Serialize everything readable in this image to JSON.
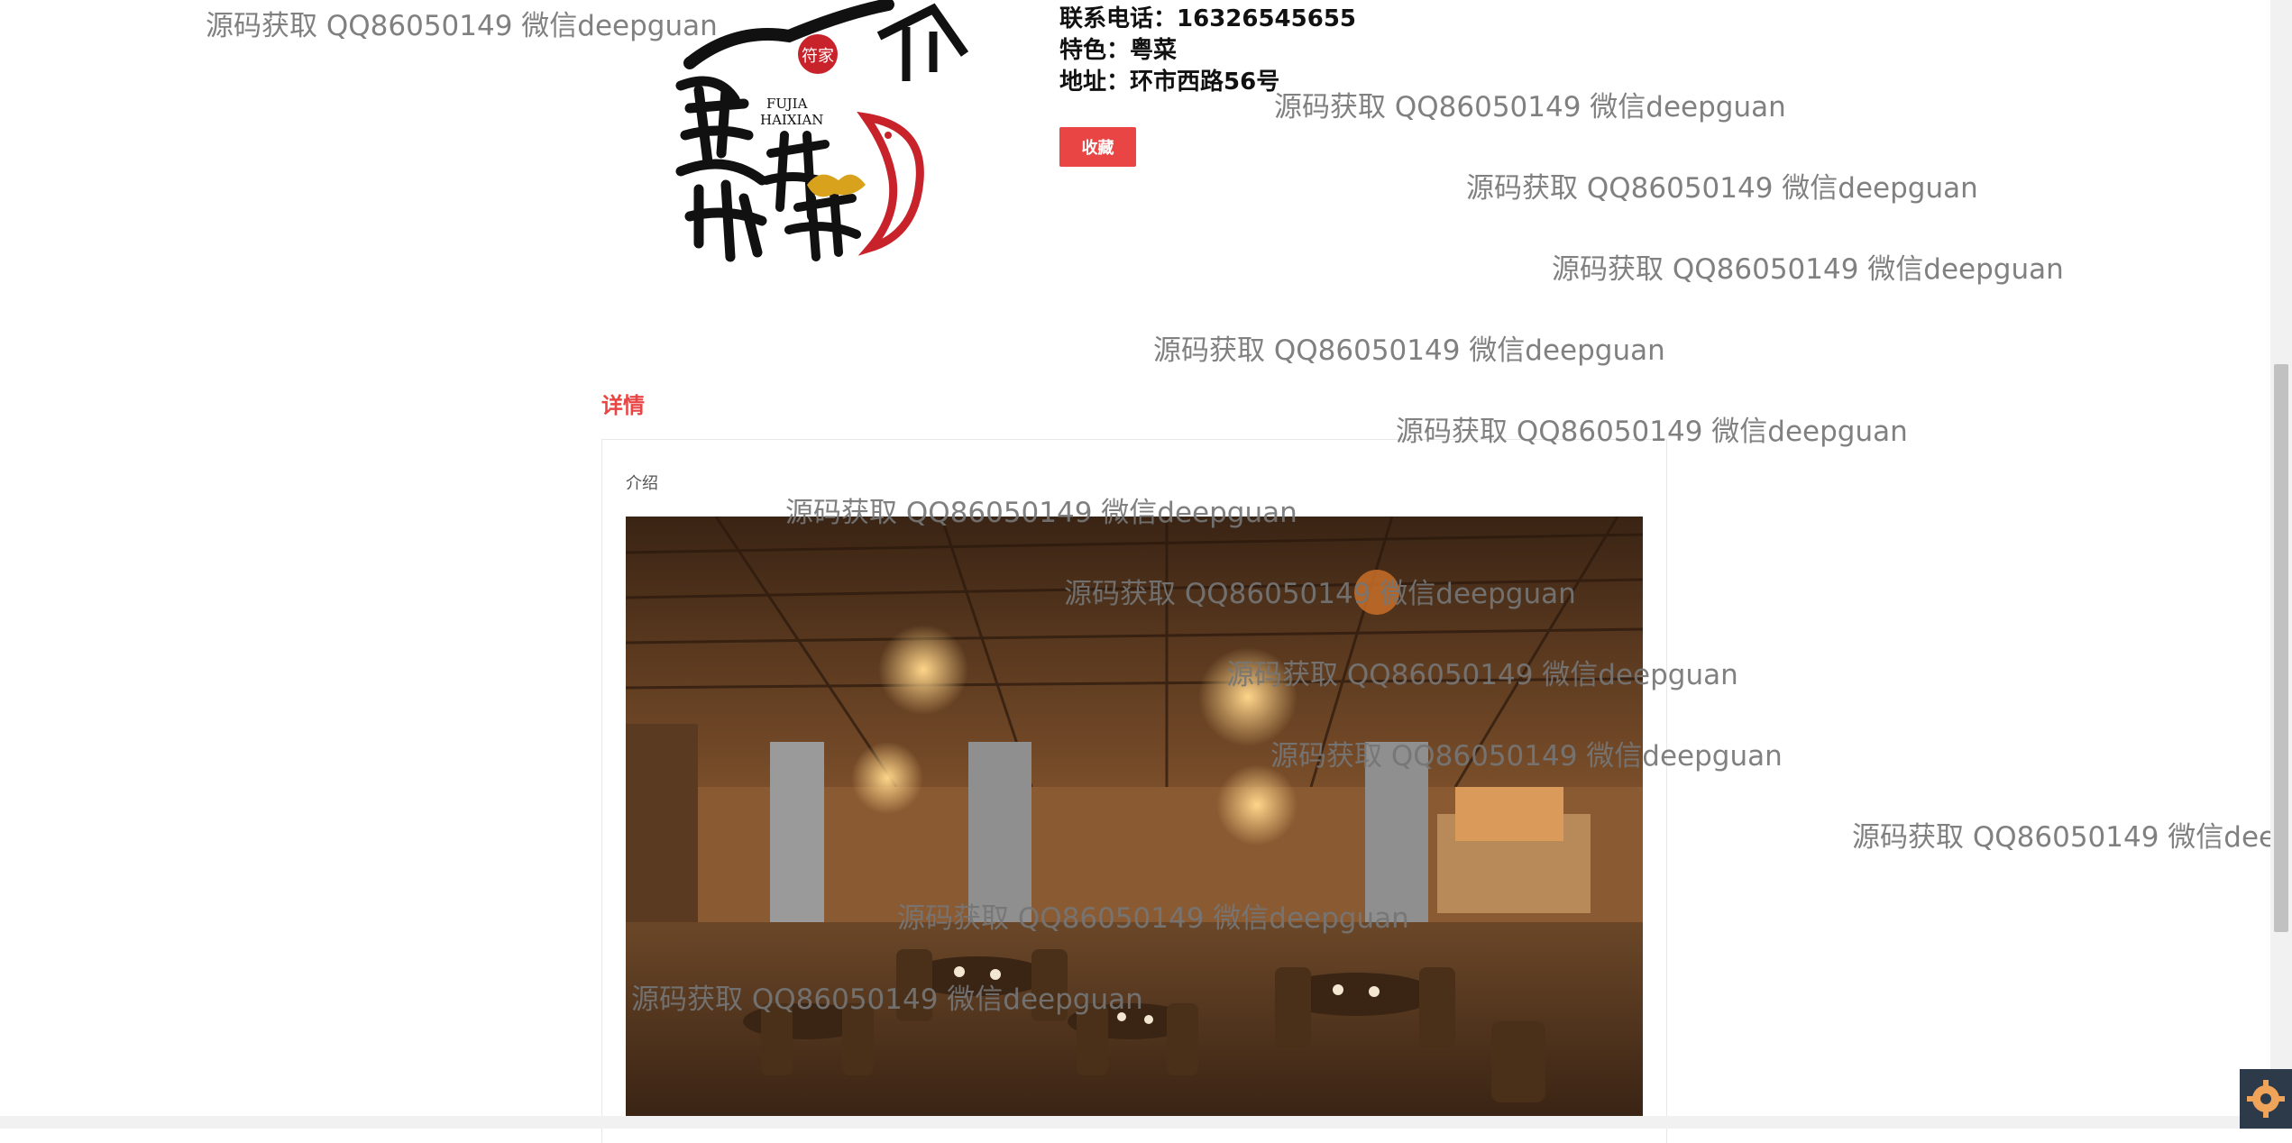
{
  "restaurant": {
    "logo_text": {
      "latin": "FUJIA HAIXIAN",
      "chinese": "符家海鲜",
      "seal": "符家"
    },
    "phone_label": "联系电话：",
    "phone_value": "16326545655",
    "specialty_label": "特色：",
    "specialty_value": "粤菜",
    "address_label": "地址：",
    "address_value": "环市西路56号",
    "favorite_button": "收藏"
  },
  "details": {
    "section_title": "详情",
    "intro_label": "介绍",
    "photo_icon": "restaurant-interior-photo"
  },
  "watermark": "源码获取 QQ86050149 微信deepguan",
  "colors": {
    "accent": "#e94545",
    "watermark": "#767676",
    "text": "#111111"
  }
}
